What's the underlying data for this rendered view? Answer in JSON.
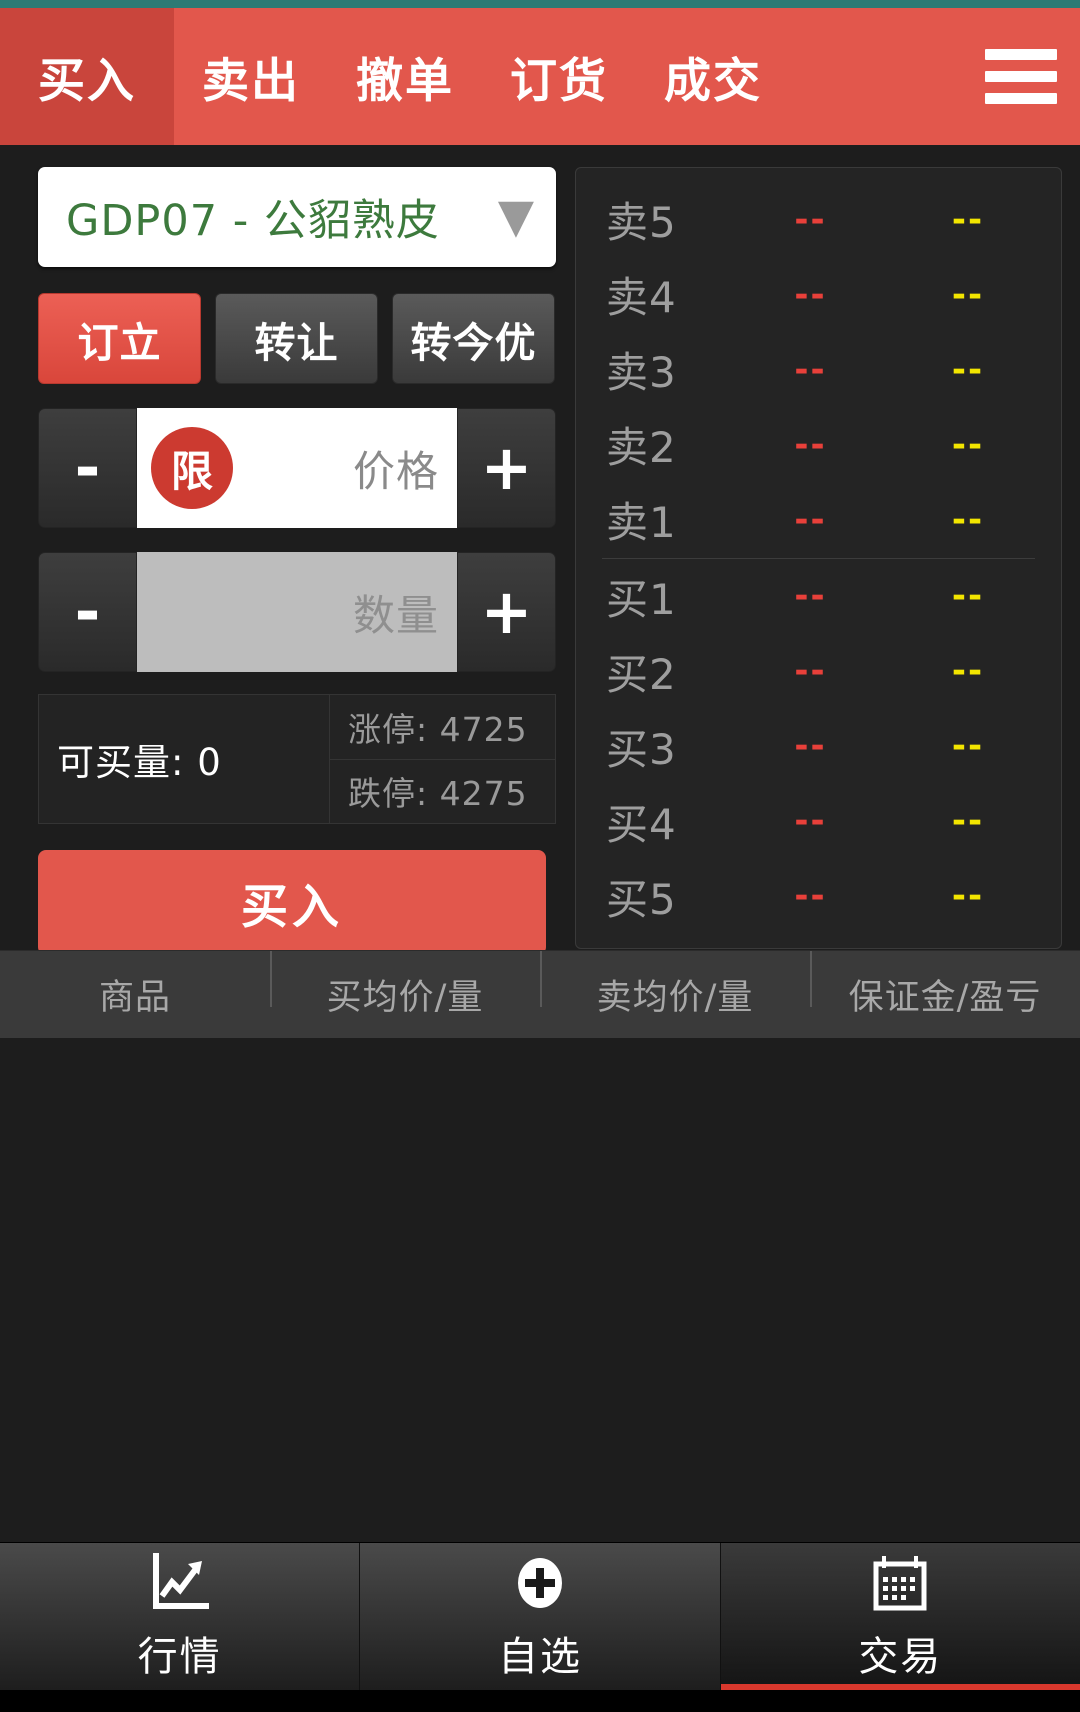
{
  "topnav": {
    "tabs": [
      {
        "label": "买入",
        "active": true
      },
      {
        "label": "卖出",
        "active": false
      },
      {
        "label": "撤单",
        "active": false
      },
      {
        "label": "订货",
        "active": false
      },
      {
        "label": "成交",
        "active": false
      }
    ],
    "menu_icon": "hamburger-menu-icon"
  },
  "order": {
    "instrument": "GDP07  -  公貂熟皮",
    "instrument_code": "GDP07",
    "instrument_name": "公貂熟皮",
    "dropdown_icon": "chevron-down-icon",
    "type_buttons": [
      {
        "label": "订立",
        "active": true
      },
      {
        "label": "转让",
        "active": false
      },
      {
        "label": "转今优",
        "active": false
      }
    ],
    "price_row": {
      "minus": "-",
      "plus": "+",
      "badge": "限",
      "placeholder": "价格",
      "value": ""
    },
    "qty_row": {
      "minus": "-",
      "plus": "+",
      "placeholder": "数量",
      "value": ""
    },
    "available": "可买量: 0",
    "upper_limit": "涨停: 4725",
    "lower_limit": "跌停: 4275",
    "submit_label": "买入"
  },
  "orderbook": {
    "sell_rows": [
      {
        "label": "卖5",
        "price": "--",
        "volume": "--"
      },
      {
        "label": "卖4",
        "price": "--",
        "volume": "--"
      },
      {
        "label": "卖3",
        "price": "--",
        "volume": "--"
      },
      {
        "label": "卖2",
        "price": "--",
        "volume": "--"
      },
      {
        "label": "卖1",
        "price": "--",
        "volume": "--"
      }
    ],
    "buy_rows": [
      {
        "label": "买1",
        "price": "--",
        "volume": "--"
      },
      {
        "label": "买2",
        "price": "--",
        "volume": "--"
      },
      {
        "label": "买3",
        "price": "--",
        "volume": "--"
      },
      {
        "label": "买4",
        "price": "--",
        "volume": "--"
      },
      {
        "label": "买5",
        "price": "--",
        "volume": "--"
      }
    ]
  },
  "positions": {
    "columns": [
      "商品",
      "买均价/量",
      "卖均价/量",
      "保证金/盈亏"
    ],
    "rows": []
  },
  "bottomnav": {
    "items": [
      {
        "label": "行情",
        "icon": "chart-line-icon",
        "active": false
      },
      {
        "label": "自选",
        "icon": "plus-circle-icon",
        "active": false
      },
      {
        "label": "交易",
        "icon": "calendar-icon",
        "active": true
      }
    ]
  },
  "colors": {
    "accent_red": "#e2574c",
    "active_tab_red": "#c9453c",
    "price_red": "#e8403a",
    "volume_yellow": "#f2e500",
    "instrument_green": "#3d7a3d",
    "panel_bg": "#1d1d1d",
    "status_strip": "#2d7a74"
  }
}
